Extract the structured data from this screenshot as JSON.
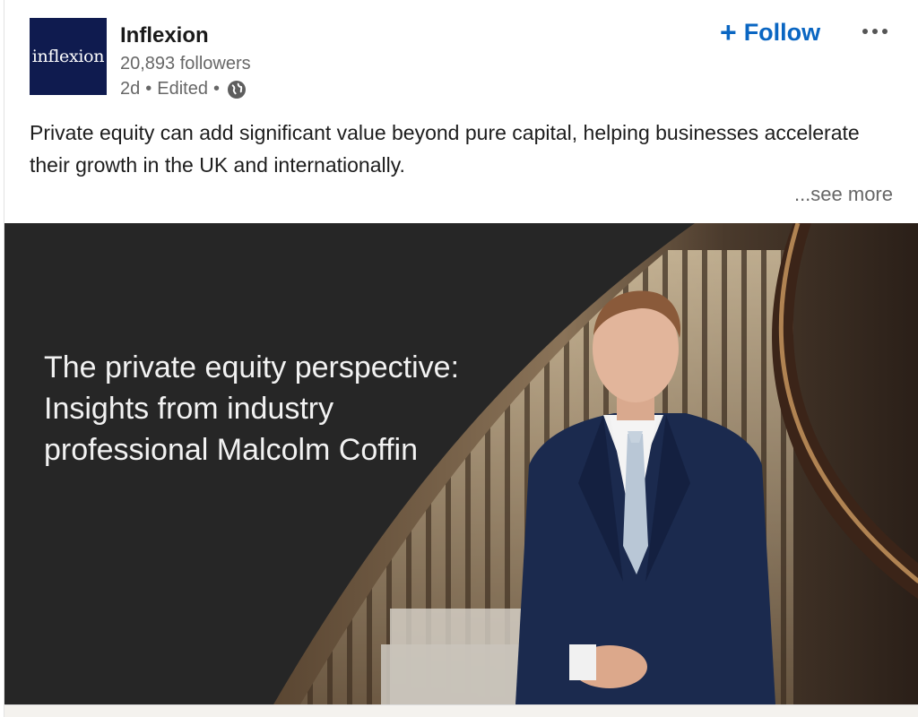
{
  "post": {
    "company_name": "Inflexion",
    "logo_text": "inflexion",
    "followers": "20,893 followers",
    "time": "2d",
    "edited": "Edited",
    "separator": "•",
    "visibility_icon": "globe-icon",
    "follow_label": "Follow",
    "follow_icon": "plus-icon",
    "more_icon": "ellipsis-icon",
    "body_text": "Private equity can add significant value beyond pure capital, helping businesses accelerate their growth in the UK and internationally.",
    "see_more": "...see more"
  },
  "media": {
    "title": "The private equity perspective: Insights from industry professional Malcolm Coffin",
    "image_description_icon": "portrait-photo"
  },
  "colors": {
    "accent": "#0a66c2",
    "logo_bg": "#0f1b4f",
    "media_bg": "#262626",
    "suit": "#1b2a4e"
  }
}
